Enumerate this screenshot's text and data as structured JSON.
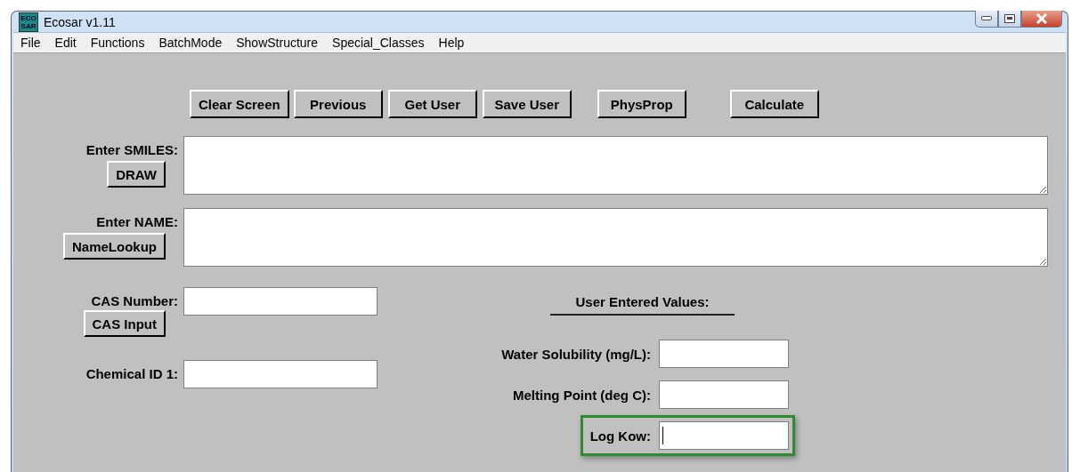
{
  "window": {
    "title": "Ecosar v1.11",
    "icon_text": [
      "ECO",
      "SAR"
    ]
  },
  "menu": [
    "File",
    "Edit",
    "Functions",
    "BatchMode",
    "ShowStructure",
    "Special_Classes",
    "Help"
  ],
  "toolbar": [
    "Clear Screen",
    "Previous",
    "Get User",
    "Save User",
    "PhysProp",
    "Calculate"
  ],
  "smiles": {
    "label": "Enter SMILES:",
    "button": "DRAW"
  },
  "name": {
    "label": "Enter NAME:",
    "button": "NameLookup"
  },
  "cas": {
    "label": "CAS Number:",
    "button": "CAS Input"
  },
  "chemical_id": {
    "label": "Chemical ID 1:"
  },
  "user_values": {
    "heading": "User Entered Values:",
    "fields": [
      {
        "label": "Water Solubility (mg/L):",
        "focused": false
      },
      {
        "label": "Melting Point (deg C):",
        "focused": false
      },
      {
        "label": "Log Kow:",
        "focused": true
      }
    ]
  }
}
